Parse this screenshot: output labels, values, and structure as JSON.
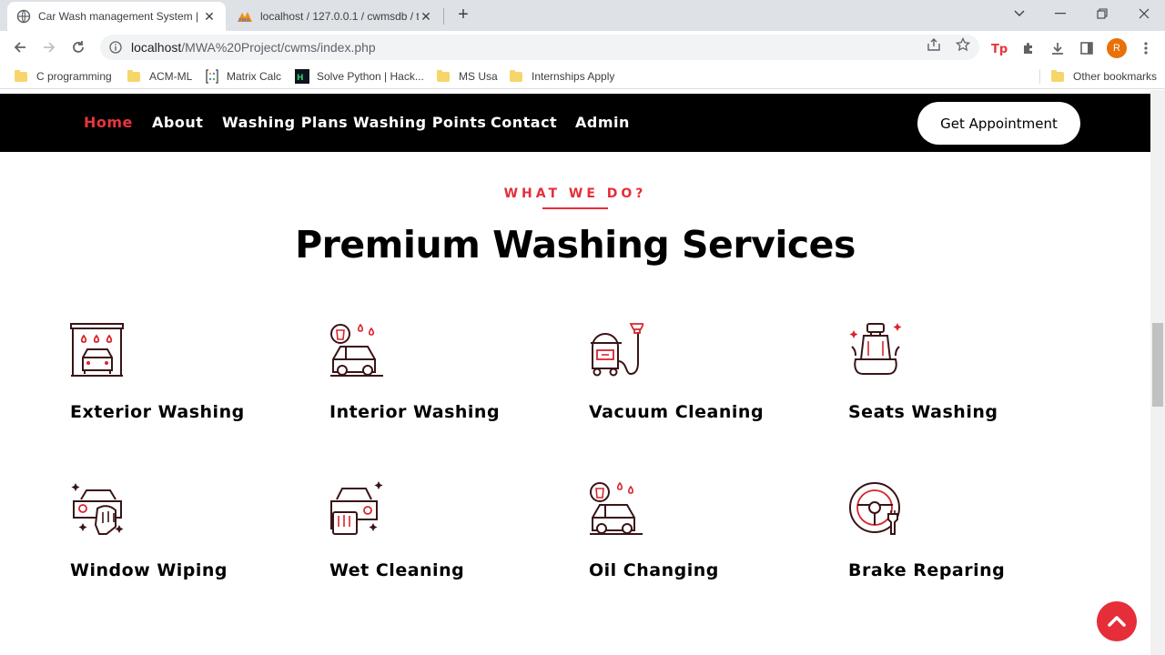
{
  "browser": {
    "tabs": [
      {
        "title": "Car Wash management System |",
        "active": true
      },
      {
        "title": "localhost / 127.0.0.1 / cwmsdb / t",
        "active": false
      }
    ],
    "url_host": "localhost",
    "url_path": "/MWA%20Project/cwms/index.php",
    "profile_initial": "R",
    "bookmarks": [
      {
        "label": "C programming",
        "icon": "folder-icon"
      },
      {
        "label": "ACM-ML",
        "icon": "folder-icon"
      },
      {
        "label": "Matrix Calc",
        "icon": "matrix-icon"
      },
      {
        "label": "Solve Python | Hack...",
        "icon": "hackerrank-icon"
      },
      {
        "label": "MS Usa",
        "icon": "folder-icon"
      },
      {
        "label": "Internships Apply",
        "icon": "folder-icon"
      }
    ],
    "other_bookmarks": "Other bookmarks"
  },
  "site": {
    "nav": [
      "Home",
      "About",
      "Washing Plans",
      "Washing Points",
      "Contact",
      "Admin"
    ],
    "active_nav": "Home",
    "cta": "Get Appointment",
    "eyebrow": "WHAT WE DO?",
    "headline": "Premium Washing Services",
    "services": [
      {
        "title": "Exterior Washing",
        "icon": "car-wash-garage-icon"
      },
      {
        "title": "Interior Washing",
        "icon": "car-interior-drops-icon"
      },
      {
        "title": "Vacuum Cleaning",
        "icon": "vacuum-cleaner-icon"
      },
      {
        "title": "Seats Washing",
        "icon": "car-seat-icon"
      },
      {
        "title": "Window Wiping",
        "icon": "window-wipe-hand-icon"
      },
      {
        "title": "Wet Cleaning",
        "icon": "wet-cleaning-sponge-icon"
      },
      {
        "title": "Oil Changing",
        "icon": "oil-change-icon"
      },
      {
        "title": "Brake Reparing",
        "icon": "steering-brake-icon"
      }
    ]
  },
  "colors": {
    "accent": "#e52e3a",
    "nav_bg": "#000000",
    "icon_dark": "#3a1416",
    "icon_red": "#d9252e"
  }
}
